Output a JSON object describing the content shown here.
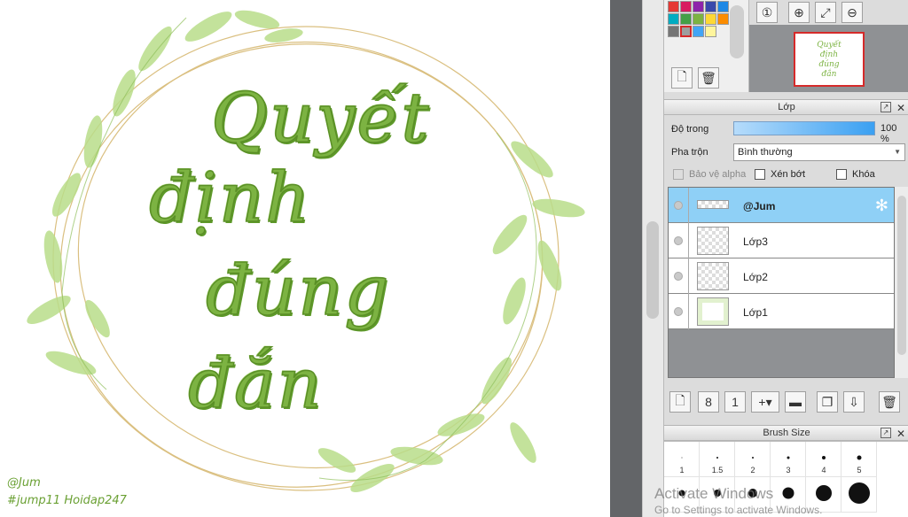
{
  "canvas": {
    "artwork_lines": [
      "Quyết",
      "định",
      "đúng",
      "đắn"
    ],
    "watermark_line1": "@Jum",
    "watermark_line2": "#jump11 Hoidap247",
    "accent_color": "#7cb342",
    "leaf_color": "#b9dd8a"
  },
  "palette": {
    "colors": [
      "#e53935",
      "#d81b60",
      "#8e24aa",
      "#3949ab",
      "#1e88e5",
      "#00acc1",
      "#43a047",
      "#7cb342",
      "#fdd835",
      "#fb8c00",
      "#757575",
      "#9e9e9e",
      "#42a5f5",
      "#fff59d"
    ],
    "new_icon": "new-page-icon",
    "delete_icon": "trash-icon"
  },
  "navigator": {
    "tools": [
      "zoom-actual-icon",
      "zoom-in-icon",
      "fit-icon",
      "zoom-out-icon"
    ]
  },
  "layer_panel": {
    "title": "Lớp",
    "opacity_label": "Độ trong",
    "opacity_value": "100 %",
    "blend_label": "Pha trộn",
    "blend_value": "Bình thường",
    "protect_alpha": "Bảo vệ alpha",
    "clipping": "Xén bớt",
    "lock": "Khóa",
    "layers": [
      {
        "name": "@Jum",
        "selected": true
      },
      {
        "name": "Lớp3",
        "selected": false
      },
      {
        "name": "Lớp2",
        "selected": false
      },
      {
        "name": "Lớp1",
        "selected": false
      }
    ]
  },
  "brush_panel": {
    "title": "Brush Size",
    "sizes": [
      "1",
      "1.5",
      "2",
      "3",
      "4",
      "5"
    ]
  },
  "os_watermark": {
    "line1": "Activate Windows",
    "line2": "Go to Settings to activate Windows."
  }
}
